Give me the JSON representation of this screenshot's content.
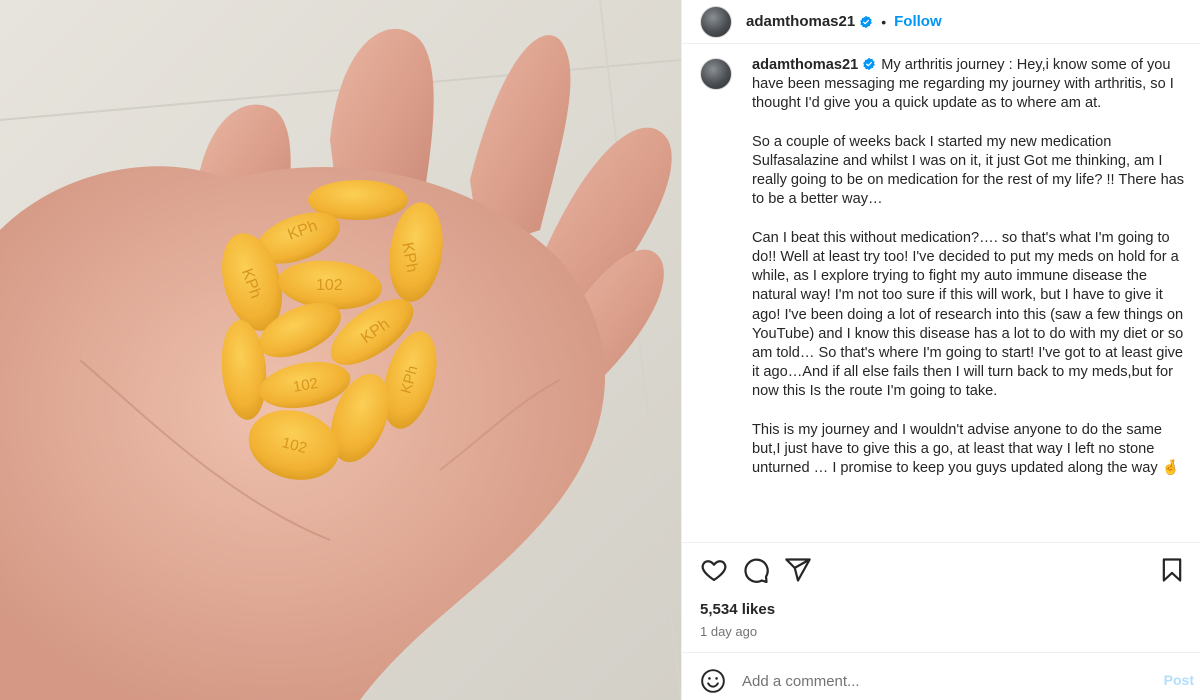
{
  "colors": {
    "link_blue": "#0095f6",
    "verified_blue": "#0095f6",
    "pill_yellow": "#f2b233",
    "post_disabled": "#b2dffc"
  },
  "post": {
    "username": "adamthomas21",
    "follow_label": "Follow",
    "separator": "•",
    "caption_paragraphs": [
      "My arthritis journey : Hey,i know some of you have been messaging me regarding my journey with arthritis, so I thought I'd give you a quick update as to where am at.",
      "So a couple of weeks back I started my new medication Sulfasalazine and whilst I was on it, it just Got me thinking, am I really going to be on medication for the rest of my life? !! There has to be a better way…",
      "Can I beat this without medication?…. so that's what I'm going to do!! Well at least try too! I've decided to put my meds on hold for a while, as I explore trying to fight my auto immune disease the natural way! I'm not too sure if this will work, but I have to give it ago! I've been doing a lot of research into this (saw a few things on YouTube) and I know this disease has a lot to do with my diet or so am told… So that's where I'm going to start! I've got to at least give it ago…And if all else fails then I will turn back to my meds,but for now this Is the route I'm going to take.",
      "This is my journey and I wouldn't advise anyone to do the same but,I just have to give this a go, at least that way I left no stone unturned … I promise to keep you guys updated along the way 🤞"
    ],
    "likes": "5,534 likes",
    "time": "1 day ago"
  },
  "pill_imprints": [
    "KPh",
    "102",
    "KPh",
    "KPh",
    "KPh",
    "102",
    "KPh",
    "102"
  ],
  "comment": {
    "placeholder": "Add a comment...",
    "post_label": "Post"
  },
  "icons": {
    "like": "heart-icon",
    "comment": "comment-icon",
    "share": "share-icon",
    "save": "bookmark-icon",
    "emoji": "emoji-icon",
    "verified": "verified-badge-icon"
  }
}
